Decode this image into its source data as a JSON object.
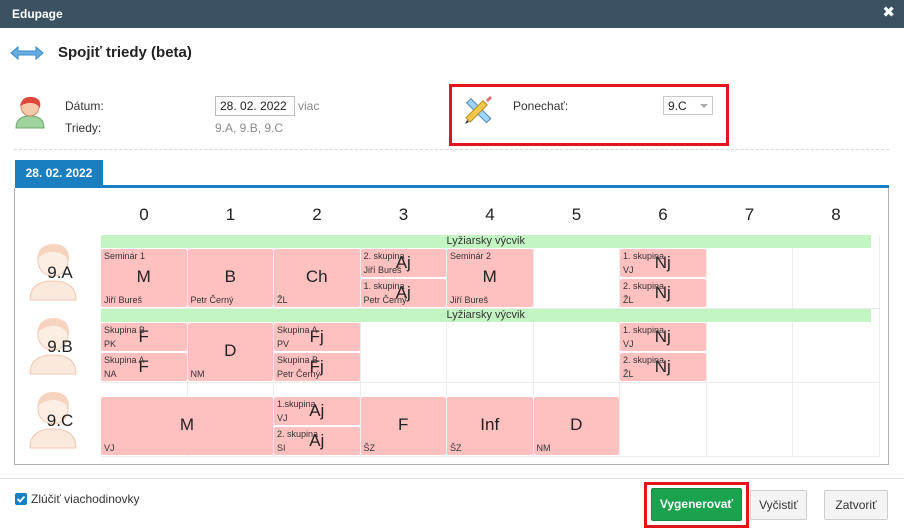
{
  "window": {
    "title": "Edupage",
    "close_glyph": "✖"
  },
  "dialog": {
    "title": "Spojiť triedy (beta)"
  },
  "info": {
    "datum_label": "Dátum:",
    "datum_value": "28. 02. 2022",
    "viac_link": "viac",
    "triedy_label": "Triedy:",
    "triedy_value": "9.A, 9.B, 9.C",
    "ponechat_label": "Ponechať:",
    "ponechat_value": "9.C"
  },
  "tab": {
    "label": "28. 02. 2022"
  },
  "columns": [
    "0",
    "1",
    "2",
    "3",
    "4",
    "5",
    "6",
    "7",
    "8"
  ],
  "rows": [
    {
      "label": "9.A",
      "banner": "Lyžiarsky výcvik",
      "lessons": [
        {
          "col": 0,
          "span": 1,
          "half": "full",
          "subject": "M",
          "group": "Seminár 1",
          "teacher": "Jiří Bureš"
        },
        {
          "col": 1,
          "span": 1,
          "half": "full",
          "subject": "B",
          "group": "",
          "teacher": "Petr Černý"
        },
        {
          "col": 2,
          "span": 1,
          "half": "full",
          "subject": "Ch",
          "group": "",
          "teacher": "ŽL"
        },
        {
          "col": 3,
          "span": 1,
          "half": "top",
          "subject": "Aj",
          "group": "2. skupina",
          "teacher": "Jiří Bureš"
        },
        {
          "col": 3,
          "span": 1,
          "half": "bottom",
          "subject": "Aj",
          "group": "1. skupina",
          "teacher": "Petr Černý"
        },
        {
          "col": 4,
          "span": 1,
          "half": "full",
          "subject": "M",
          "group": "Seminár 2",
          "teacher": "Jiří Bureš"
        },
        {
          "col": 6,
          "span": 1,
          "half": "top",
          "subject": "Nj",
          "group": "1. skupina",
          "teacher": "VJ"
        },
        {
          "col": 6,
          "span": 1,
          "half": "bottom",
          "subject": "Nj",
          "group": "2. skupina",
          "teacher": "ŽL"
        }
      ]
    },
    {
      "label": "9.B",
      "banner": "Lyžiarsky výcvik",
      "lessons": [
        {
          "col": 0,
          "span": 1,
          "half": "top",
          "subject": "F",
          "group": "Skupina B",
          "teacher": "PK"
        },
        {
          "col": 0,
          "span": 1,
          "half": "bottom",
          "subject": "F",
          "group": "Skupina A",
          "teacher": "NA"
        },
        {
          "col": 1,
          "span": 1,
          "half": "full",
          "subject": "D",
          "group": "",
          "teacher": "NM"
        },
        {
          "col": 2,
          "span": 1,
          "half": "top",
          "subject": "Fj",
          "group": "Skupina A",
          "teacher": "PV"
        },
        {
          "col": 2,
          "span": 1,
          "half": "bottom",
          "subject": "Fj",
          "group": "Skupina B",
          "teacher": "Petr Černý"
        },
        {
          "col": 6,
          "span": 1,
          "half": "top",
          "subject": "Nj",
          "group": "1. skupina",
          "teacher": "VJ"
        },
        {
          "col": 6,
          "span": 1,
          "half": "bottom",
          "subject": "Nj",
          "group": "2. skupina",
          "teacher": "ŽL"
        }
      ]
    },
    {
      "label": "9.C",
      "banner": "",
      "lessons": [
        {
          "col": 0,
          "span": 2,
          "half": "full",
          "subject": "M",
          "group": "",
          "teacher": "VJ"
        },
        {
          "col": 2,
          "span": 1,
          "half": "top",
          "subject": "Aj",
          "group": "1.skupina",
          "teacher": "VJ"
        },
        {
          "col": 2,
          "span": 1,
          "half": "bottom",
          "subject": "Aj",
          "group": "2. skupina",
          "teacher": "SI"
        },
        {
          "col": 3,
          "span": 1,
          "half": "full",
          "subject": "F",
          "group": "",
          "teacher": "ŠZ"
        },
        {
          "col": 4,
          "span": 1,
          "half": "full",
          "subject": "Inf",
          "group": "",
          "teacher": "ŠZ"
        },
        {
          "col": 5,
          "span": 1,
          "half": "full",
          "subject": "D",
          "group": "",
          "teacher": "NM"
        }
      ]
    }
  ],
  "footer": {
    "merge_label": "Zlúčiť viachodinovky",
    "merge_checked": true,
    "generate_label": "Vygenerovať",
    "clear_label": "Vyčistiť",
    "close_label": "Zatvoriť"
  },
  "colors": {
    "titlebar": "#3b5263",
    "accent": "#1a7fc0",
    "lesson": "#ffc0c0",
    "event": "#c3f5c3",
    "highlight": "#e1161c",
    "primary_button": "#1aa24e"
  },
  "icons": {
    "dialog": "double-arrow-icon",
    "info": "user-avatar-icon",
    "keep": "pencil-ruler-icon",
    "row": "student-avatar-icon"
  }
}
